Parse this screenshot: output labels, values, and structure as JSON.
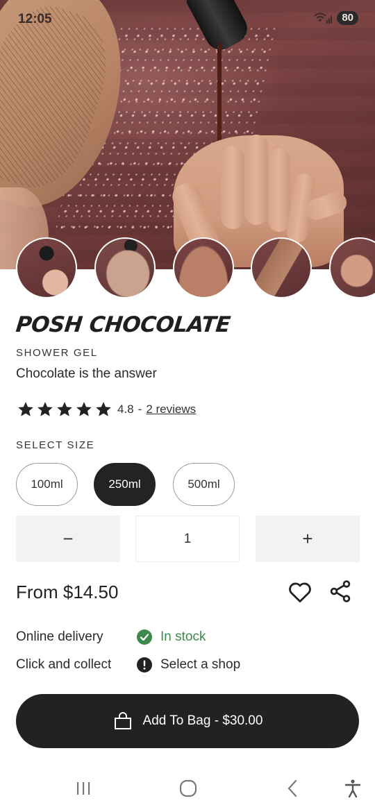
{
  "status_bar": {
    "time": "12:05",
    "battery": "80"
  },
  "hero": {
    "thumbnails": [
      "thumb-1",
      "thumb-2",
      "thumb-3",
      "thumb-4",
      "thumb-5"
    ]
  },
  "product": {
    "name": "POSH CHOCOLATE",
    "category": "SHOWER GEL",
    "tagline": "Chocolate is the answer",
    "rating": "4.8",
    "rating_separator": "-",
    "reviews_link": "2 reviews",
    "stars": 5
  },
  "size_selector": {
    "label": "SELECT SIZE",
    "options": [
      "100ml",
      "250ml",
      "500ml"
    ],
    "selected": "250ml"
  },
  "quantity": {
    "decrement": "−",
    "value": "1",
    "increment": "+"
  },
  "price": {
    "label": "From $14.50"
  },
  "actions": {
    "favorite_icon": "heart-icon",
    "share_icon": "share-icon"
  },
  "availability": {
    "online": {
      "label": "Online delivery",
      "status": "In stock",
      "icon": "check-circle-icon",
      "color": "#3e8a4d"
    },
    "collect": {
      "label": "Click and collect",
      "status": "Select a shop",
      "icon": "exclamation-circle-icon"
    }
  },
  "add_to_bag": {
    "label": "Add To Bag - $30.00",
    "icon": "bag-icon"
  },
  "nav_bar": {
    "items": [
      "recent-apps-icon",
      "home-icon",
      "back-icon",
      "accessibility-icon"
    ]
  },
  "colors": {
    "primary": "#222222",
    "success": "#3e8a4d",
    "hero_bg": "#6e3b3a"
  }
}
